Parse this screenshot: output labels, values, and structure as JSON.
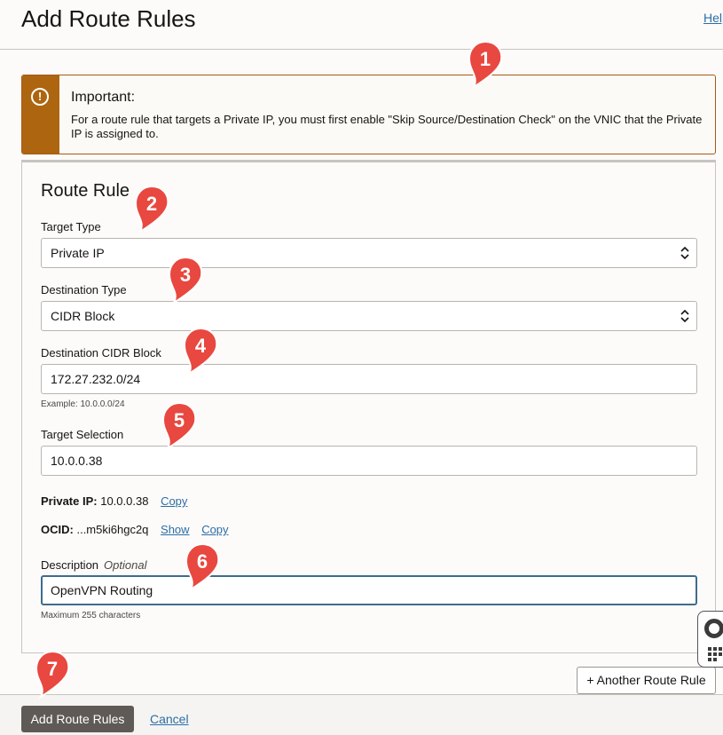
{
  "header": {
    "title": "Add Route Rules",
    "help_label": "Help"
  },
  "alert": {
    "title": "Important:",
    "text": "For a route rule that targets a Private IP, you must first enable \"Skip Source/Destination Check\" on the VNIC that the Private IP is assigned to."
  },
  "rule": {
    "section_title": "Route Rule",
    "target_type": {
      "label": "Target Type",
      "value": "Private IP"
    },
    "destination_type": {
      "label": "Destination Type",
      "value": "CIDR Block"
    },
    "destination_cidr": {
      "label": "Destination CIDR Block",
      "value": "172.27.232.0/24",
      "hint": "Example: 10.0.0.0/24"
    },
    "target_selection": {
      "label": "Target Selection",
      "value": "10.0.0.38"
    },
    "private_ip": {
      "label": "Private IP:",
      "value": "10.0.0.38",
      "copy_label": "Copy"
    },
    "ocid": {
      "label": "OCID:",
      "value": "...m5ki6hgc2q",
      "show_label": "Show",
      "copy_label": "Copy"
    },
    "description": {
      "label": "Description",
      "optional_label": "Optional",
      "value": "OpenVPN Routing",
      "hint": "Maximum 255 characters"
    }
  },
  "buttons": {
    "another_rule": "+ Another Route Rule",
    "submit": "Add Route Rules",
    "cancel": "Cancel"
  },
  "callouts": [
    "1",
    "2",
    "3",
    "4",
    "5",
    "6",
    "7"
  ],
  "colors": {
    "accent": "#ad650f",
    "callout": "#e8483f",
    "link": "#2c6ea5",
    "primary": "#5f5a55"
  },
  "icons": {
    "alert": "warning-circle-icon",
    "select": "chevron-updown-icon",
    "help_widget": "lifebuoy-icon"
  }
}
